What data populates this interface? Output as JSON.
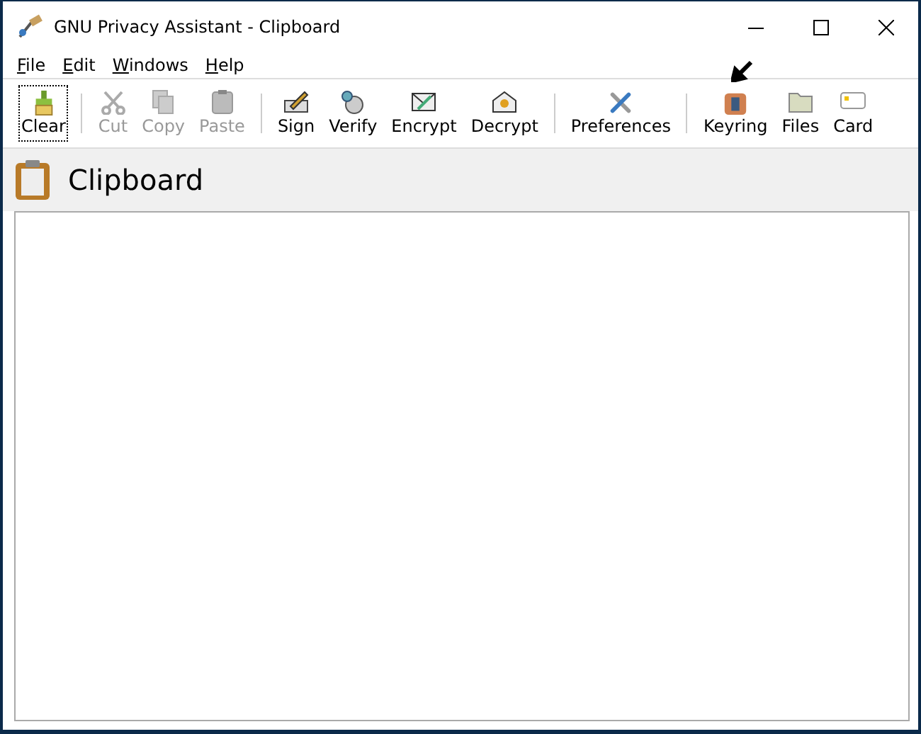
{
  "window": {
    "title": "GNU Privacy Assistant - Clipboard"
  },
  "menu": [
    "File",
    "Edit",
    "Windows",
    "Help"
  ],
  "toolbar": [
    {
      "kind": "button",
      "label": "Clear",
      "disabled": false,
      "focused": true
    },
    {
      "kind": "separator"
    },
    {
      "kind": "button",
      "label": "Cut",
      "disabled": true,
      "focused": false
    },
    {
      "kind": "button",
      "label": "Copy",
      "disabled": true,
      "focused": false
    },
    {
      "kind": "button",
      "label": "Paste",
      "disabled": true,
      "focused": false
    },
    {
      "kind": "separator"
    },
    {
      "kind": "button",
      "label": "Sign",
      "disabled": false,
      "focused": false
    },
    {
      "kind": "button",
      "label": "Verify",
      "disabled": false,
      "focused": false
    },
    {
      "kind": "button",
      "label": "Encrypt",
      "disabled": false,
      "focused": false
    },
    {
      "kind": "button",
      "label": "Decrypt",
      "disabled": false,
      "focused": false
    },
    {
      "kind": "separator"
    },
    {
      "kind": "button",
      "label": "Preferences",
      "disabled": false,
      "focused": false
    },
    {
      "kind": "separator"
    },
    {
      "kind": "button",
      "label": "Keyring",
      "disabled": false,
      "focused": false,
      "pointer": true
    },
    {
      "kind": "button",
      "label": "Files",
      "disabled": false,
      "focused": false
    },
    {
      "kind": "button",
      "label": "Card",
      "disabled": false,
      "focused": false
    }
  ],
  "page": {
    "title": "Clipboard"
  }
}
